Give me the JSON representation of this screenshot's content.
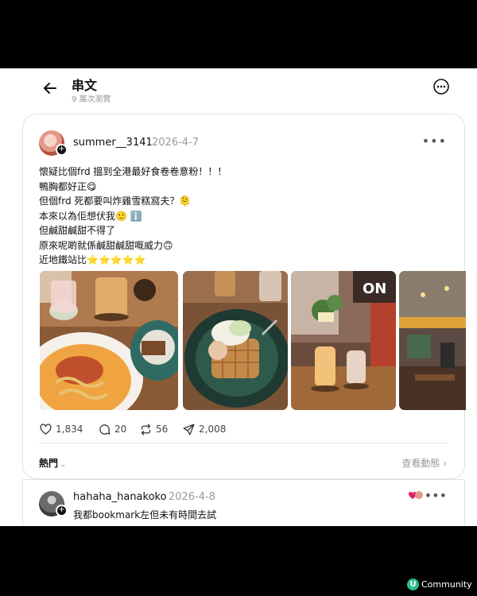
{
  "header": {
    "title": "串文",
    "subtitle": "9 萬次瀏覽"
  },
  "post": {
    "username": "summer__3141",
    "date": "2026-4-7",
    "lines": [
      "懷疑比個frd 搵到全港最好食卷卷意粉！！！",
      "鴨胸都好正😋",
      "但個frd 死都要叫炸雞雪糕窩夫？🫠",
      "本來以為佢想伏我🙂 ℹ️",
      "但鹹甜鹹甜不得了",
      "原來呢啲就係鹹甜鹹甜嘅威力🙃",
      "近地鐵站比⭐⭐⭐⭐⭐"
    ],
    "photos": [
      {
        "name": "pasta-and-drinks-photo"
      },
      {
        "name": "waffle-ice-cream-photo"
      },
      {
        "name": "drinks-neon-sign-photo",
        "sign_text": "ON"
      },
      {
        "name": "restaurant-interior-photo"
      }
    ],
    "stats": {
      "likes": "1,834",
      "comments": "20",
      "reposts": "56",
      "shares": "2,008"
    }
  },
  "sort": {
    "label": "熱門",
    "view_activity": "查看動態"
  },
  "reply": {
    "username": "hahaha_hanakoko",
    "date": "2026-4-8",
    "text": "我都bookmark左但未有時間去試"
  },
  "brand": {
    "logo": "U",
    "text": "Community",
    "color": "#2bbf8c"
  },
  "colors": {
    "accent_yellow": "#f2b01e",
    "muted_text": "#999999",
    "border": "#e2e2e2"
  }
}
